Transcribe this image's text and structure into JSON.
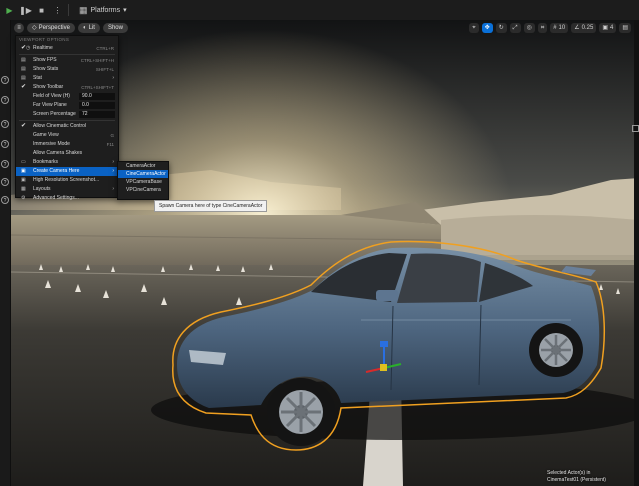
{
  "toolbar": {
    "platforms_label": "Platforms",
    "icons": [
      "play-icon",
      "step-icon",
      "stop-icon",
      "menu-icon",
      "platforms-icon"
    ]
  },
  "viewport": {
    "perspective_label": "Perspective",
    "lit_label": "Lit",
    "show_label": "Show",
    "right_controls": [
      "10",
      "0.25",
      "4"
    ]
  },
  "menu": {
    "header": "VIEWPORT OPTIONS",
    "items": [
      {
        "label": "Realtime",
        "shortcut": "CTRL+R",
        "check": true
      },
      {
        "label": "Show FPS",
        "shortcut": "CTRL+SHIFT+H"
      },
      {
        "label": "Show Stats",
        "shortcut": "SHIFT+L"
      },
      {
        "label": "Stat",
        "arrow": true
      },
      {
        "label": "Show Toolbar",
        "shortcut": "CTRL+SHIFT+T",
        "check": true
      }
    ],
    "fields": [
      {
        "label": "Field of View (H)",
        "value": "90.0"
      },
      {
        "label": "Far View Plane",
        "value": "0.0"
      },
      {
        "label": "Screen Percentage",
        "value": "72"
      }
    ],
    "items2": [
      {
        "label": "Allow Cinematic Control",
        "check": true
      },
      {
        "label": "Game View",
        "shortcut": "G"
      },
      {
        "label": "Immersive Mode",
        "shortcut": "F11"
      },
      {
        "label": "Allow Camera Shakes"
      },
      {
        "label": "Bookmarks",
        "arrow": true
      },
      {
        "label": "Create Camera Here",
        "arrow": true,
        "selected": true
      },
      {
        "label": "High Resolution Screenshot..."
      },
      {
        "label": "Layouts",
        "arrow": true
      },
      {
        "label": "Advanced Settings..."
      }
    ]
  },
  "submenu": {
    "items": [
      {
        "label": "CameraActor"
      },
      {
        "label": "CineCameraActor",
        "selected": true
      },
      {
        "label": "VPCameraBase"
      },
      {
        "label": "VPCineCamera"
      }
    ]
  },
  "tooltip": "Spawn Camera here of type CineCameraActor",
  "status": {
    "line1": "Selected Actor(s) in",
    "line2": "CinemaTest01 (Persistent)"
  },
  "colors": {
    "selection_blue": "#0a62c4",
    "outline_orange": "#f0a020",
    "car_body": "#4e6680"
  }
}
